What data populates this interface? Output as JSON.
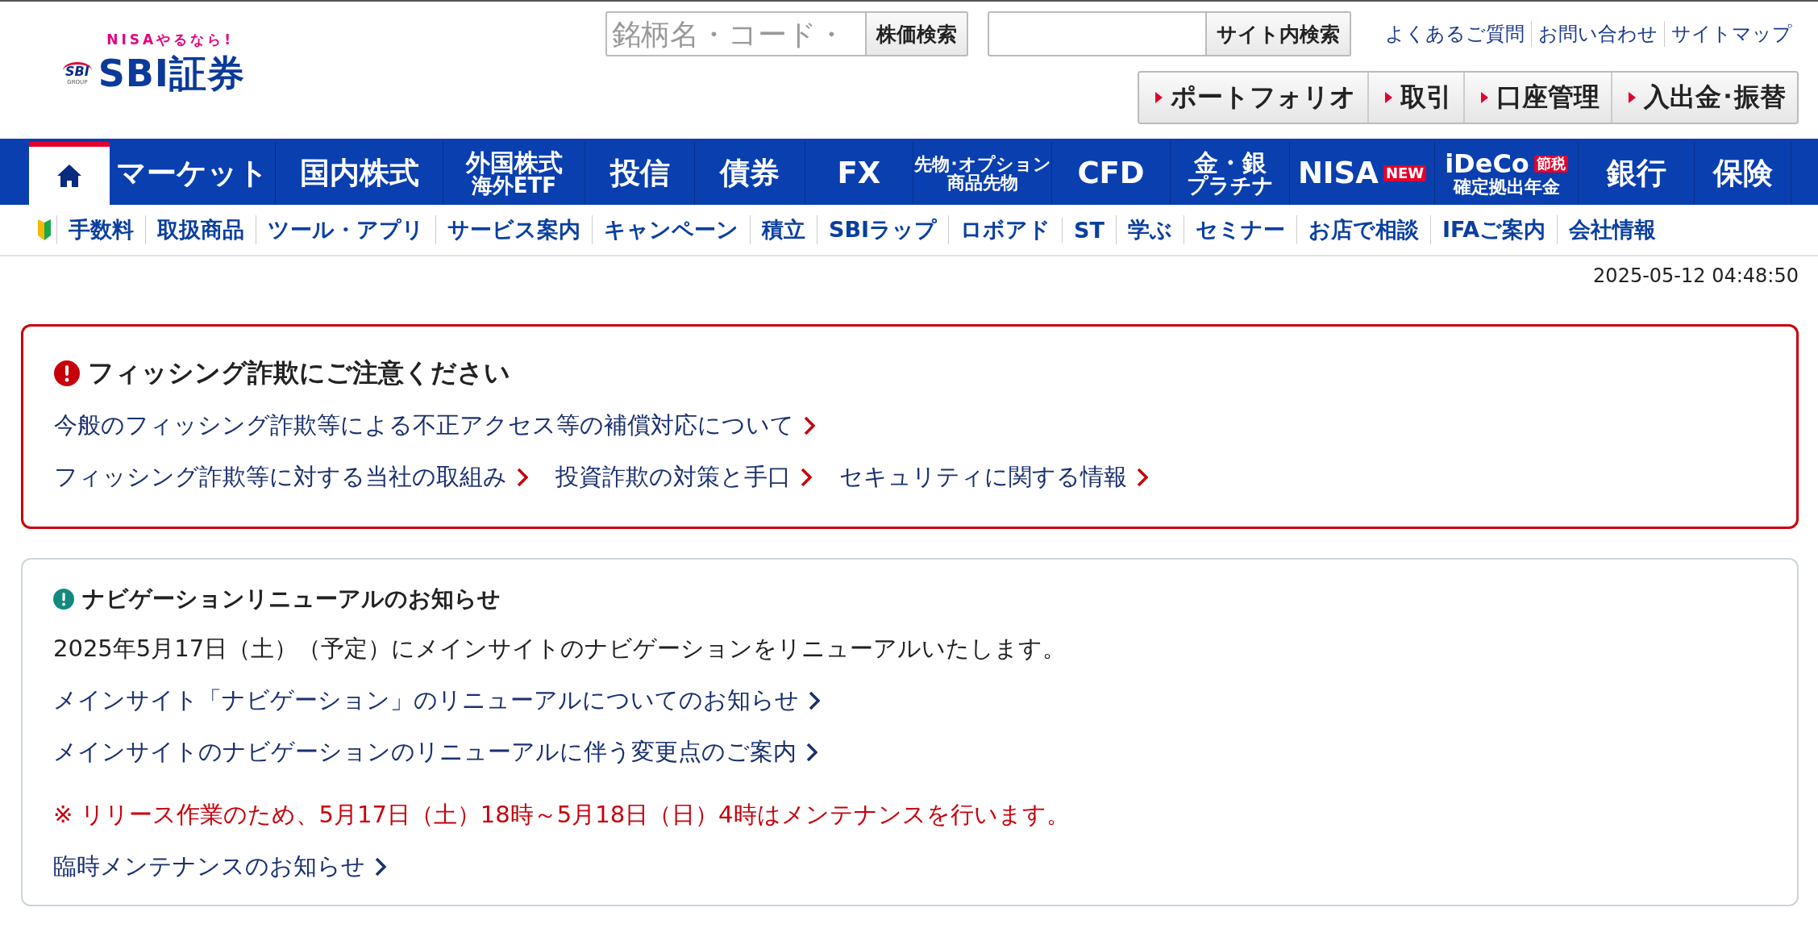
{
  "header": {
    "logo": {
      "tagline": "NISAやるなら!",
      "mark": "SBI",
      "mark_sub": "GROUP",
      "name": "SBI証券"
    },
    "searches": [
      {
        "placeholder": "銘柄名・コード・",
        "button": "株価検索"
      },
      {
        "button": "サイト内検索"
      }
    ],
    "top_links": [
      "よくあるご質問",
      "お問い合わせ",
      "サイトマップ"
    ],
    "action_buttons": [
      "ポートフォリオ",
      "取引",
      "口座管理",
      "入出金･振替"
    ]
  },
  "main_nav": [
    {
      "kind": "home",
      "selected": true
    },
    {
      "kind": "text",
      "label": "マーケット",
      "selected": false
    },
    {
      "kind": "text",
      "label": "国内株式",
      "selected": false
    },
    {
      "kind": "two-line",
      "label": "外国株式",
      "sublabel": "海外ETF",
      "selected": false
    },
    {
      "kind": "text",
      "label": "投信",
      "selected": false
    },
    {
      "kind": "text",
      "label": "債券",
      "selected": false
    },
    {
      "kind": "text",
      "label": "FX",
      "selected": false
    },
    {
      "kind": "two-line-small",
      "label": "先物･オプション",
      "sublabel": "商品先物",
      "selected": false
    },
    {
      "kind": "text",
      "label": "CFD",
      "selected": false
    },
    {
      "kind": "two-line",
      "label": "金・銀",
      "sublabel": "プラチナ",
      "selected": false
    },
    {
      "kind": "badge",
      "label": "NISA",
      "badge": "NEW",
      "selected": false
    },
    {
      "kind": "badge-two-line",
      "label": "iDeCo",
      "badge": "節税",
      "sublabel": "確定拠出年金",
      "selected": false
    },
    {
      "kind": "text",
      "label": "銀行",
      "selected": false
    },
    {
      "kind": "text",
      "label": "保険",
      "selected": false
    }
  ],
  "sub_nav": [
    "手数料",
    "取扱商品",
    "ツール・アプリ",
    "サービス案内",
    "キャンペーン",
    "積立",
    "SBIラップ",
    "ロボアド",
    "ST",
    "学ぶ",
    "セミナー",
    "お店で相談",
    "IFAご案内",
    "会社情報"
  ],
  "timestamp": "2025-05-12 04:48:50",
  "notices": [
    {
      "kind": "warning",
      "title": "フィッシング詐欺にご注意ください",
      "rows": [
        {
          "kind": "links",
          "links": [
            "今般のフィッシング詐欺等による不正アクセス等の補償対応について"
          ]
        },
        {
          "kind": "links",
          "links": [
            "フィッシング詐欺等に対する当社の取組み",
            "投資詐欺の対策と手口",
            "セキュリティに関する情報"
          ]
        }
      ]
    },
    {
      "kind": "info",
      "title": "ナビゲーションリニューアルのお知らせ",
      "rows": [
        {
          "kind": "text",
          "text": "2025年5月17日（土）（予定）にメインサイトのナビゲーションをリニューアルいたします。"
        },
        {
          "kind": "links",
          "links": [
            "メインサイト「ナビゲーション」のリニューアルについてのお知らせ"
          ]
        },
        {
          "kind": "links",
          "links": [
            "メインサイトのナビゲーションのリニューアルに伴う変更点のご案内"
          ]
        },
        {
          "kind": "note",
          "text": "※ リリース作業のため、5月17日（土）18時～5月18日（日）4時はメンテナンスを行います。"
        },
        {
          "kind": "links",
          "links": [
            "臨時メンテナンスのお知らせ"
          ]
        }
      ]
    }
  ]
}
